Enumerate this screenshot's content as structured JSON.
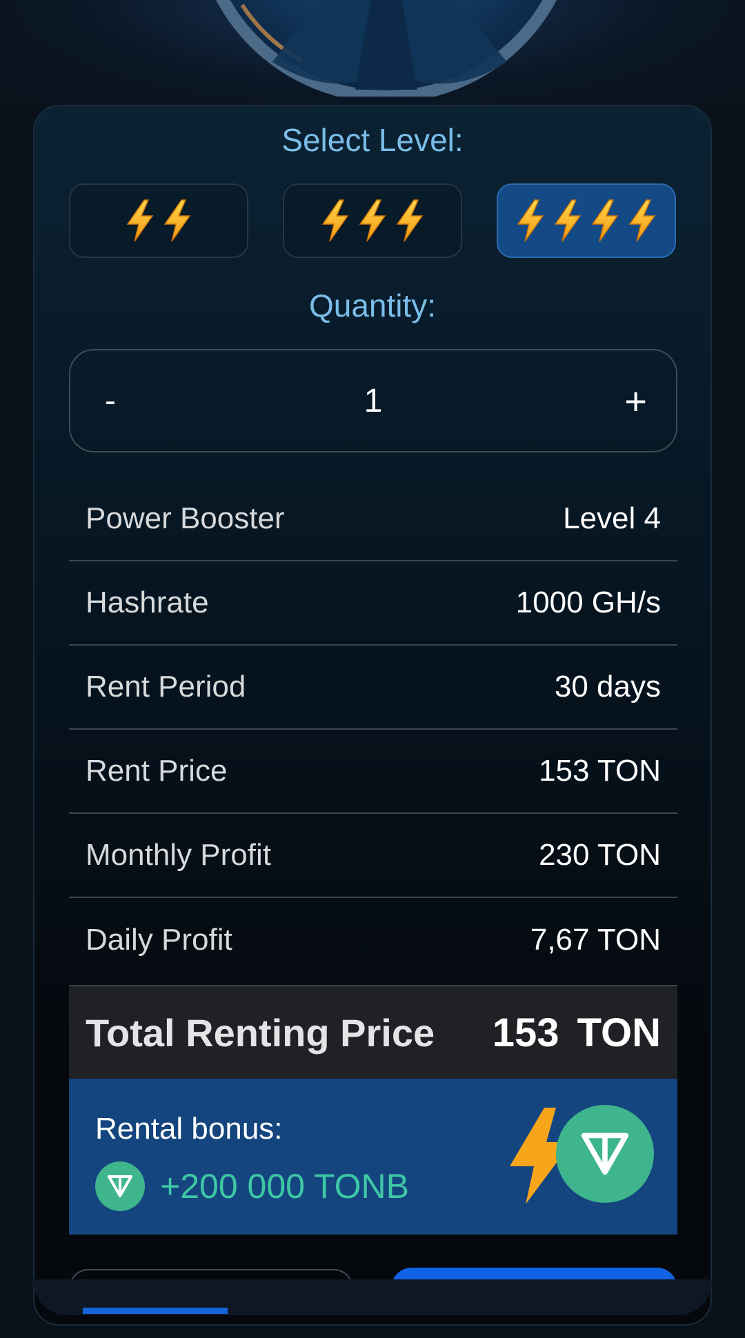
{
  "level_selector": {
    "label": "Select Level:",
    "levels": [
      {
        "bolts": 2,
        "selected": false
      },
      {
        "bolts": 3,
        "selected": false
      },
      {
        "bolts": 4,
        "selected": true
      }
    ]
  },
  "quantity": {
    "label": "Quantity:",
    "minus": "-",
    "value": "1",
    "plus": "+"
  },
  "details": [
    {
      "key": "Power Booster",
      "value": "Level 4"
    },
    {
      "key": "Hashrate",
      "value": "1000 GH/s"
    },
    {
      "key": "Rent Period",
      "value": "30 days"
    },
    {
      "key": "Rent Price",
      "value": "153 TON"
    },
    {
      "key": "Monthly Profit",
      "value": "230 TON"
    },
    {
      "key": "Daily Profit",
      "value": "7,67 TON"
    }
  ],
  "total": {
    "label": "Total Renting Price",
    "value": "153 TON"
  },
  "bonus": {
    "label": "Rental bonus:",
    "amount": "+200 000 TONB"
  },
  "colors": {
    "accent": "#1262e5",
    "bonus_bg": "#14457f",
    "ton_green": "#3fb58e",
    "bolt": "#f7a51b"
  }
}
